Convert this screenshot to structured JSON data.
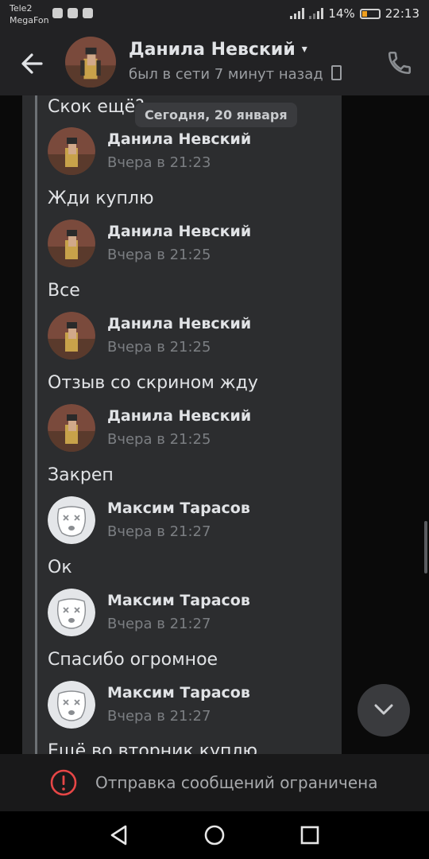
{
  "status_bar": {
    "carrier_1": "Tele2",
    "carrier_2": "MegaFon",
    "battery": "14%",
    "time": "22:13"
  },
  "header": {
    "back_icon": "arrow-left-icon",
    "name": "Данила Невский",
    "status": "был в сети 7 минут назад",
    "call_icon": "phone-icon"
  },
  "date_divider": "Сегодня, 20 января",
  "messages": [
    {
      "text": "Скок ещё?"
    },
    {
      "author": "Данила Невский",
      "time": "Вчера в 21:23",
      "text": "Жди куплю",
      "avatar": "soldier-avatar"
    },
    {
      "author": "Данила Невский",
      "time": "Вчера в 21:25",
      "text": "Все",
      "avatar": "soldier-avatar"
    },
    {
      "author": "Данила Невский",
      "time": "Вчера в 21:25",
      "text": "Отзыв со скрином жду",
      "avatar": "soldier-avatar"
    },
    {
      "author": "Данила Невский",
      "time": "Вчера в 21:25",
      "text": "Закреп",
      "avatar": "soldier-avatar"
    },
    {
      "author": "Максим Тарасов",
      "time": "Вчера в 21:27",
      "text": "Ок",
      "avatar": "deactivated-dog-avatar"
    },
    {
      "author": "Максим Тарасов",
      "time": "Вчера в 21:27",
      "text": "Спасибо огромное",
      "avatar": "deactivated-dog-avatar"
    },
    {
      "author": "Максим Тарасов",
      "time": "Вчера в 21:27",
      "text": "Ещё во вторник куплю",
      "avatar": "deactivated-dog-avatar"
    }
  ],
  "restricted_notice": "Отправка сообщений ограничена",
  "colors": {
    "background": "#0a0a0a",
    "panel": "#2c2d2f",
    "header": "#222224",
    "warning": "#e64646"
  }
}
